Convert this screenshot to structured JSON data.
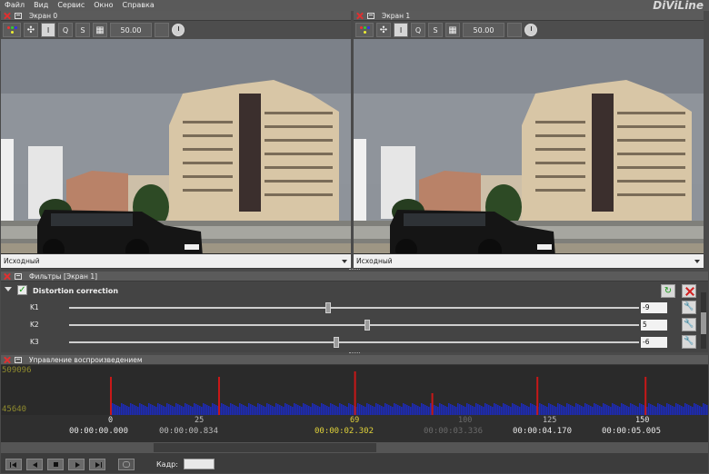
{
  "app": {
    "brand": "DiViLine"
  },
  "menu": [
    "Файл",
    "Вид",
    "Сервис",
    "Окно",
    "Справка"
  ],
  "screens": [
    {
      "title": "Экран 0",
      "toolbar": {
        "mode_i": "I",
        "mode_q": "Q",
        "mode_s": "S",
        "zoom": "50.00"
      },
      "source": "Исходный"
    },
    {
      "title": "Экран 1",
      "toolbar": {
        "mode_i": "I",
        "mode_q": "Q",
        "mode_s": "S",
        "zoom": "50.00"
      },
      "source": "Исходный"
    }
  ],
  "filters": {
    "title": "Фильтры [Экран 1]",
    "filter": {
      "name": "Distortion correction",
      "enabled": true,
      "params": [
        {
          "label": "K1",
          "value": "-9",
          "slider_fraction": 0.455
        },
        {
          "label": "K2",
          "value": "5",
          "slider_fraction": 0.523
        },
        {
          "label": "K3",
          "value": "-6",
          "slider_fraction": 0.469
        }
      ]
    }
  },
  "playback": {
    "title": "Управление воспроизведением",
    "y_max": "509096",
    "y_min": "45640",
    "frame_label": "Кадр:",
    "frame_value": "",
    "markers": [
      {
        "frame": "0",
        "color": "#e8e8e8"
      },
      {
        "frame": "25",
        "color": "#bdbdbd"
      },
      {
        "frame": "69",
        "color": "#e0d23a"
      },
      {
        "frame": "100",
        "color": "#6a6a6a"
      },
      {
        "frame": "125",
        "color": "#bdbdbd"
      },
      {
        "frame": "150",
        "color": "#e8e8e8"
      }
    ],
    "timecodes": [
      {
        "text": "00:00:00.000",
        "color": "#e8e8e8"
      },
      {
        "text": "00:00:00.834",
        "color": "#bdbdbd"
      },
      {
        "text": "00:00:02.302",
        "color": "#e0d23a"
      },
      {
        "text": "00:00:03.336",
        "color": "#6a6a6a"
      },
      {
        "text": "00:00:04.170",
        "color": "#e8e8e8"
      },
      {
        "text": "00:00:05.005",
        "color": "#e8e8e8"
      }
    ],
    "buttons": [
      "skip-back",
      "step-back",
      "stop",
      "play",
      "step-forward",
      "loop"
    ]
  },
  "colors": {
    "accent_red": "#e03030",
    "bar_blue": "#1d2bb8",
    "keyframe_red": "#c81818",
    "label_olive": "#8f8b2e"
  }
}
